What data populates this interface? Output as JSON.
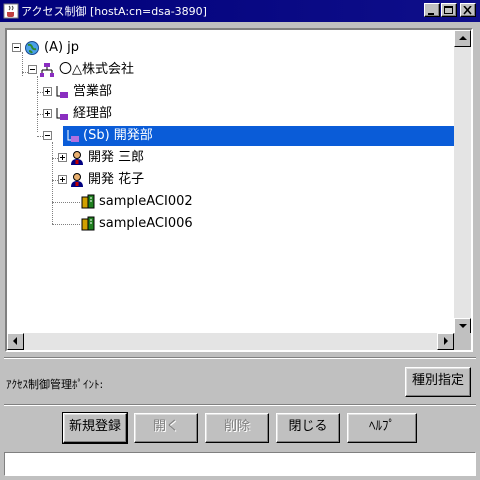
{
  "window": {
    "title": "アクセス制御 [hostA:cn=dsa-3890]"
  },
  "tree": {
    "nodes": [
      {
        "label": "(A) jp",
        "icon": "globe-icon"
      },
      {
        "label": "〇△株式会社",
        "icon": "organization-icon"
      },
      {
        "label": "営業部",
        "icon": "org-unit-icon"
      },
      {
        "label": "経理部",
        "icon": "org-unit-icon"
      },
      {
        "label": "(Sb) 開発部",
        "icon": "org-unit-icon",
        "selected": true
      },
      {
        "label": "開発 三郎",
        "icon": "person-icon"
      },
      {
        "label": "開発 花子",
        "icon": "person-icon"
      },
      {
        "label": "sampleACI002",
        "icon": "aci-icon"
      },
      {
        "label": "sampleACI006",
        "icon": "aci-icon"
      }
    ]
  },
  "access_point_label": "ｱｸｾｽ制御管理ﾎﾟｲﾝﾄ:",
  "buttons": {
    "kind": "種別指定",
    "register": "新規登録",
    "open": "開く",
    "delete": "削除",
    "close": "閉じる",
    "help": "ﾍﾙﾌﾟ"
  },
  "colors": {
    "titlebar": "#00007b",
    "selection": "#0a5cd8",
    "face": "#c0c0c0"
  }
}
